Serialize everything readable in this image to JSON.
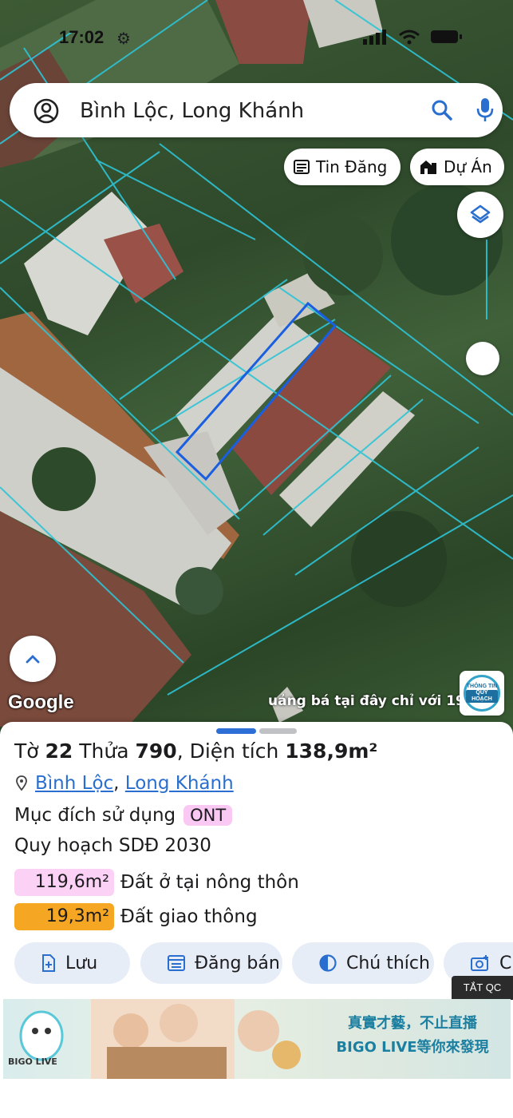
{
  "status_bar": {
    "time": "17:02"
  },
  "search": {
    "query": "Bình Lộc, Long Khánh"
  },
  "chips": {
    "tin_dang": "Tin Đăng",
    "du_an": "Dự Án"
  },
  "map": {
    "google_label": "Google",
    "ad_text": "uảng bá tại đây chỉ với 19",
    "badge_line1": "THÔNG TIN",
    "badge_line2": "QUY HOẠCH"
  },
  "parcel": {
    "title_prefix": "Tờ",
    "sheet_no": "22",
    "plot_prefix": "Thửa",
    "plot_no": "790",
    "area_prefix": ", Diện tích",
    "area": "138,9m²",
    "location": {
      "ward": "Bình Lộc",
      "separator": ",",
      "city": "Long Khánh"
    },
    "purpose_label": "Mục đích sử dụng",
    "purpose_code": "ONT",
    "plan_label": "Quy hoạch SDĐ 2030",
    "land_use": [
      {
        "area": "119,6m²",
        "label": "Đất ở tại nông thôn",
        "color": "#fbd1f5"
      },
      {
        "area": "19,3m²",
        "label": "Đất giao thông",
        "color": "#f5a623"
      }
    ]
  },
  "actions": {
    "save": "Lưu",
    "sell": "Đăng bán",
    "legend": "Chú thích",
    "capture": "Ch"
  },
  "ad": {
    "close_label": "TẮT QC",
    "slogan_line1": "真實才藝，不止直播",
    "slogan_line2": "BIGO LIVE等你來發現",
    "brand": "BIGO LIVE"
  },
  "colors": {
    "accent": "#2a6fcf",
    "parcel_outline": "#1a5fe0",
    "cadastral_line": "#2ec4d6"
  }
}
